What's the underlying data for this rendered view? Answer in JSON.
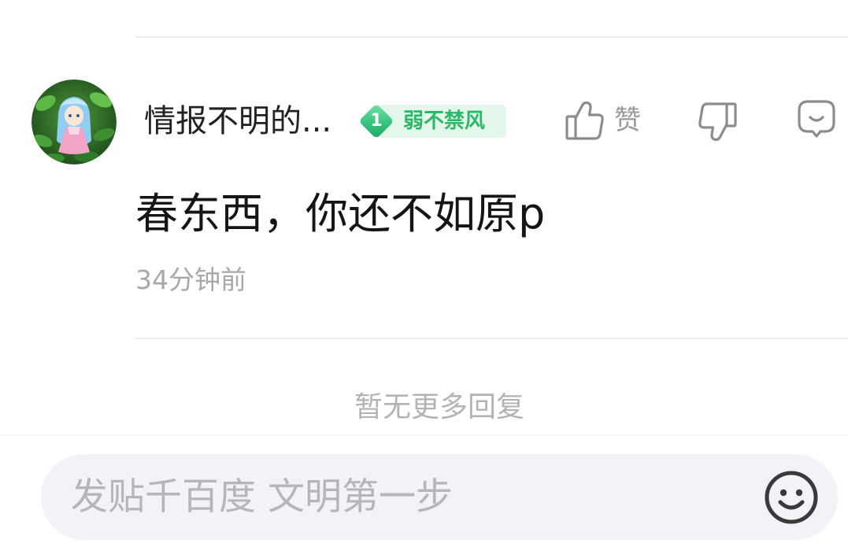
{
  "comment": {
    "author": {
      "name": "情报不明的...",
      "level": "1",
      "level_title": "弱不禁风"
    },
    "text": "春东西，你还不如原p",
    "time": "34分钟前",
    "actions": {
      "like_label": "赞",
      "like_icon": "thumbs-up-icon",
      "dislike_icon": "thumbs-down-icon",
      "reply_icon": "reply-bubble-icon"
    }
  },
  "replies_footer": "暂无更多回复",
  "composer": {
    "placeholder": "发贴千百度 文明第一步",
    "emoji_icon": "smiley-icon"
  },
  "colors": {
    "level_green": "#2bb868",
    "level_bg": "#e4f7eb",
    "input_bg": "#f5f2f7",
    "icon_gray": "#8c8c8c",
    "text_primary": "#151515",
    "text_secondary": "#a8a8a8"
  }
}
